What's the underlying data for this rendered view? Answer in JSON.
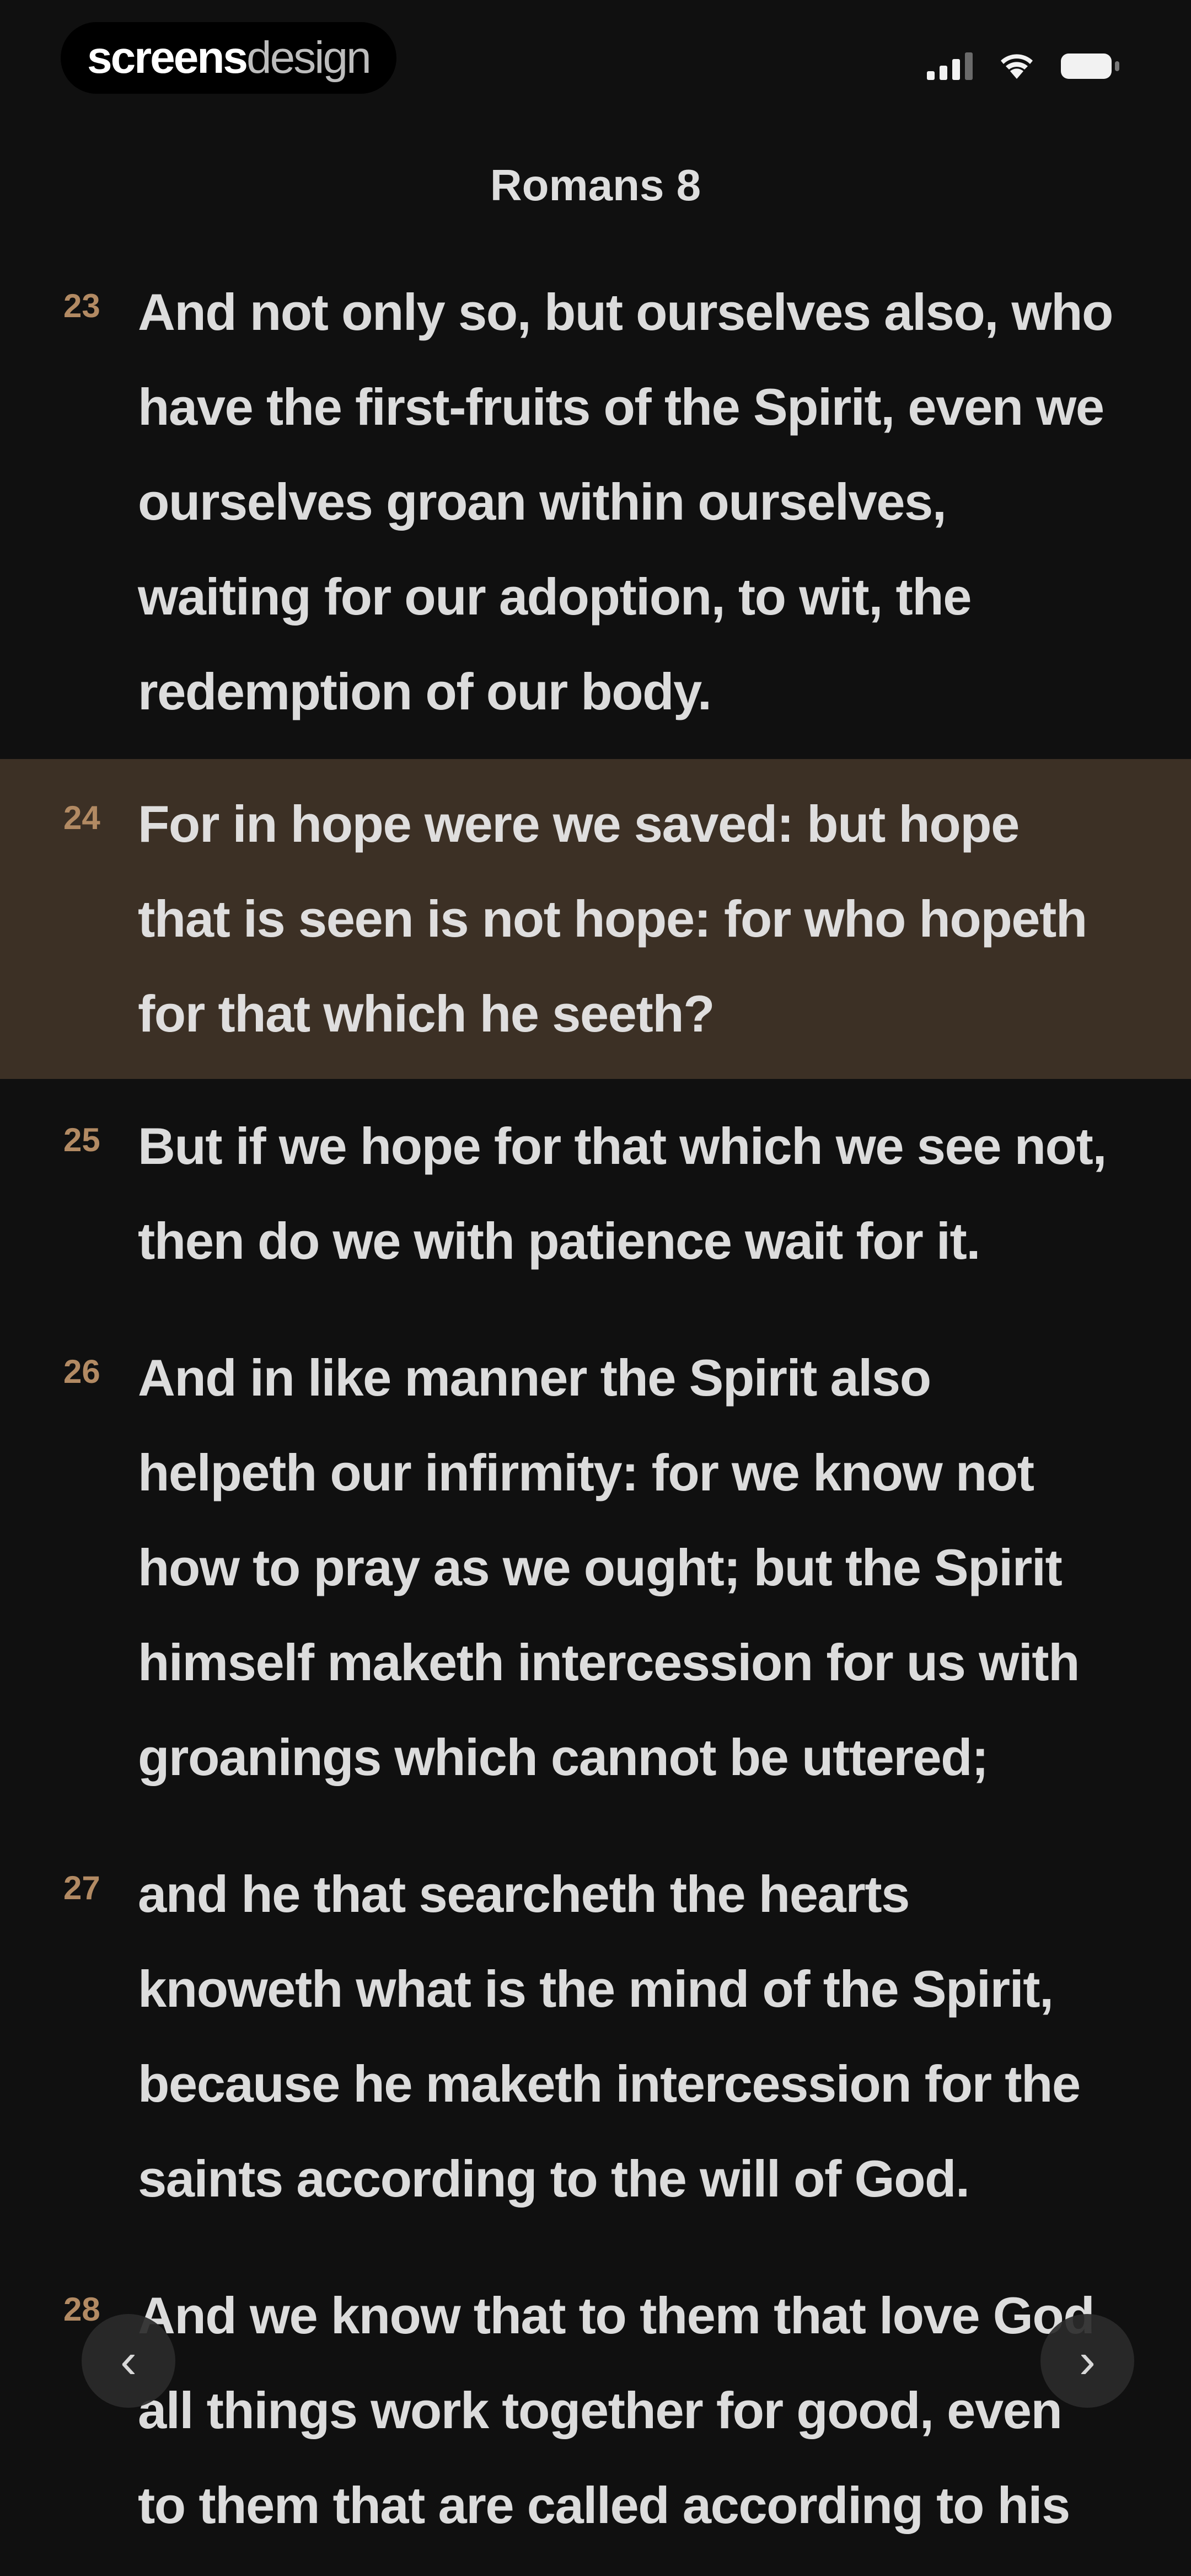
{
  "status_bar": {
    "brand_bold": "screens",
    "brand_light": "design",
    "icons": [
      "signal-icon",
      "wifi-icon",
      "battery-icon"
    ]
  },
  "chapter": {
    "title": "Romans 8"
  },
  "verses": [
    {
      "number": "23",
      "text": "And not only so, but ourselves also, who have the first-fruits of the Spirit, even we ourselves groan within ourselves, waiting for our adoption, to wit, the redemption of our body.",
      "highlighted": false
    },
    {
      "number": "24",
      "text": "For in hope were we saved: but hope that is seen is not hope: for who hopeth for that which he seeth?",
      "highlighted": true
    },
    {
      "number": "25",
      "text": "But if we hope for that which we see not, then do we with patience wait for it.",
      "highlighted": false
    },
    {
      "number": "26",
      "text": "And in like manner the Spirit also helpeth our infirmity: for we know not how to pray as we ought; but the Spirit himself maketh intercession for us with groanings which cannot be uttered;",
      "highlighted": false
    },
    {
      "number": "27",
      "text": "and he that searcheth the hearts knoweth what is the mind of the Spirit, because he maketh intercession for the saints according to the will of God.",
      "highlighted": false
    },
    {
      "number": "28",
      "text": "And we know that to them that love God all things work together for good, even to them that are called according to his",
      "highlighted": false
    }
  ],
  "navigation": {
    "prev_icon": "‹",
    "next_icon": "›"
  },
  "colors": {
    "background": "#101010",
    "highlight": "#3c3025",
    "verse_number": "#b28a63"
  }
}
